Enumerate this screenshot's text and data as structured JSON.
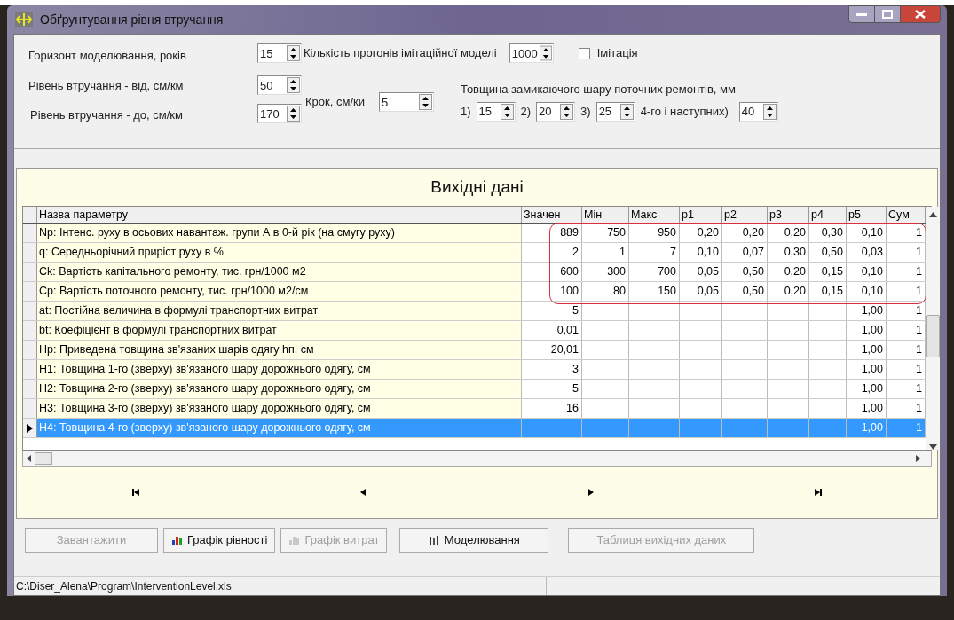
{
  "window": {
    "title": "Обґрунтування рівня втручання"
  },
  "settings": {
    "horizon_label": "Горизонт моделювання, років",
    "horizon": "15",
    "runs_label": "Кількість прогонів імітаційної моделі",
    "runs": "1000",
    "imitation": {
      "label": "Імітація",
      "checked": false
    },
    "from_label": "Рівень втручання - від, см/км",
    "from": "50",
    "to_label": "Рівень втручання - до, см/км",
    "to": "170",
    "step_label": "Крок, см/ки",
    "step": "5",
    "thickness_label": "Товщина замикаючого шару поточних ремонтів, мм",
    "thickness": [
      {
        "label": "1)",
        "value": "15"
      },
      {
        "label": "2)",
        "value": "20"
      },
      {
        "label": "3)",
        "value": "25"
      },
      {
        "label": "4-го і наступних)",
        "value": "40"
      }
    ]
  },
  "grid": {
    "title": "Вихідні дані",
    "columns": [
      "Назва параметру",
      "Значен",
      "Мін",
      "Макс",
      "p1",
      "p2",
      "p3",
      "p4",
      "p5",
      "Сум"
    ],
    "rows": [
      {
        "name": "Np: Інтенс. руху в осьових навантаж. групи А в 0-й рік (на смугу руху)",
        "value": "889",
        "min": "750",
        "max": "950",
        "p1": "0,20",
        "p2": "0,20",
        "p3": "0,20",
        "p4": "0,30",
        "p5": "0,10",
        "sum": "1",
        "selected": false
      },
      {
        "name": "q: Середньорічний приріст руху в %",
        "value": "2",
        "min": "1",
        "max": "7",
        "p1": "0,10",
        "p2": "0,07",
        "p3": "0,30",
        "p4": "0,50",
        "p5": "0,03",
        "sum": "1",
        "selected": false
      },
      {
        "name": "Ck: Вартість капітального ремонту, тис. грн/1000 м2",
        "value": "600",
        "min": "300",
        "max": "700",
        "p1": "0,05",
        "p2": "0,50",
        "p3": "0,20",
        "p4": "0,15",
        "p5": "0,10",
        "sum": "1",
        "selected": false
      },
      {
        "name": "Cp: Вартість поточного ремонту, тис. грн/1000 м2/см",
        "value": "100",
        "min": "80",
        "max": "150",
        "p1": "0,05",
        "p2": "0,50",
        "p3": "0,20",
        "p4": "0,15",
        "p5": "0,10",
        "sum": "1",
        "selected": false
      },
      {
        "name": "at: Постійна величина в формулі транспортних витрат",
        "value": "5",
        "p5": "1,00",
        "sum": "1",
        "selected": false
      },
      {
        "name": "bt: Коефіцієнт в формулі транспортних витрат",
        "value": "0,01",
        "p5": "1,00",
        "sum": "1",
        "selected": false
      },
      {
        "name": "Hp: Приведена товщина зв'язаних шарів одягу hп, см",
        "value": "20,01",
        "p5": "1,00",
        "sum": "1",
        "selected": false
      },
      {
        "name": "H1: Товщина 1-го (зверху) зв'язаного шару дорожнього одягу, см",
        "value": "3",
        "p5": "1,00",
        "sum": "1",
        "selected": false
      },
      {
        "name": "H2: Товщина 2-го (зверху) зв'язаного шару дорожнього одягу, см",
        "value": "5",
        "p5": "1,00",
        "sum": "1",
        "selected": false
      },
      {
        "name": "H3: Товщина 3-го (зверху) зв'язаного шару дорожнього одягу, см",
        "value": "16",
        "p5": "1,00",
        "sum": "1",
        "selected": false
      },
      {
        "name": "H4: Товщина 4-го (зверху) зв'язаного шару дорожнього одягу, см",
        "p5": "1,00",
        "sum": "1",
        "selected": true
      }
    ]
  },
  "buttons": [
    {
      "label": "Завантажити",
      "disabled": true,
      "kind": "plain"
    },
    {
      "label": "Графік рівності",
      "disabled": false,
      "kind": "chart"
    },
    {
      "label": "Графік витрат",
      "disabled": true,
      "kind": "chart"
    },
    {
      "label": "Моделювання",
      "disabled": false,
      "kind": "bars"
    },
    {
      "label": "Таблиця вихідних даних",
      "disabled": true,
      "kind": "plain"
    }
  ],
  "status_bar": {
    "path": "C:\\Diser_Alena\\Program\\InterventionLevel.xls"
  }
}
